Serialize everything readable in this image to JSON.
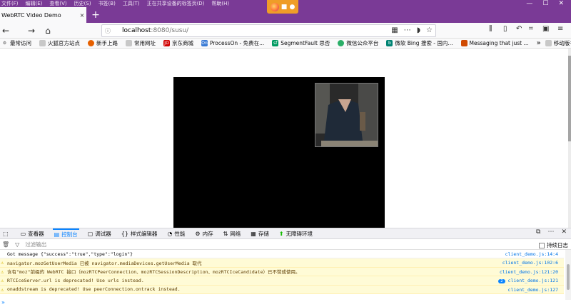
{
  "menubar": [
    "文件(F)",
    "编辑(E)",
    "查看(V)",
    "历史(S)",
    "书签(B)",
    "工具(T)",
    "正在共享设备的标签页(D)",
    "帮助(H)"
  ],
  "tab": {
    "title": "WebRTC Video Demo",
    "close": "×"
  },
  "newtab": "+",
  "url": {
    "host": "localhost",
    "rest": ":8080/susu/"
  },
  "bookmarks": [
    {
      "label": "最常访问",
      "color": "#2b6fd6"
    },
    {
      "label": "火狐官方站点",
      "color": "#e66000"
    },
    {
      "label": "新手上路",
      "color": "#e66000"
    },
    {
      "label": "常用网址",
      "color": "#888888"
    },
    {
      "label": "京东商城",
      "color": "#d00000"
    },
    {
      "label": "ProcessOn - 免费在...",
      "color": "#3a7bd5"
    },
    {
      "label": "SegmentFault 思否",
      "color": "#009a61"
    },
    {
      "label": "微信公众平台",
      "color": "#2aae67"
    },
    {
      "label": "微软 Bing 搜索 - 国内...",
      "color": "#008373"
    },
    {
      "label": "Messaging that just ...",
      "color": "#d04a02"
    }
  ],
  "bookmarks_more": "»",
  "mobile_bookmarks": "移动版书签",
  "devtools_tabs": [
    {
      "label": "查看器",
      "icon": "inspector-icon"
    },
    {
      "label": "控制台",
      "icon": "console-icon",
      "active": true
    },
    {
      "label": "调试器",
      "icon": "debugger-icon"
    },
    {
      "label": "样式编辑器",
      "icon": "style-editor-icon"
    },
    {
      "label": "性能",
      "icon": "performance-icon"
    },
    {
      "label": "内存",
      "icon": "memory-icon"
    },
    {
      "label": "网络",
      "icon": "network-icon"
    },
    {
      "label": "存储",
      "icon": "storage-icon"
    },
    {
      "label": "无障碍环境",
      "icon": "accessibility-icon"
    }
  ],
  "filter_placeholder": "过滤输出",
  "persist_logs": "持续日志",
  "console": [
    {
      "type": "log",
      "msg": "Got message {\"success\":\"true\",\"type\":\"login\"}",
      "src": "client_demo.js:14:4"
    },
    {
      "type": "warn",
      "msg": "navigator.mozGetUserMedia 已被 navigator.mediaDevices.getUserMedia 取代",
      "src": "client_demo.js:102:6"
    },
    {
      "type": "warn",
      "msg": "含有\"moz\"前缀的 WebRTC 接口（mozRTCPeerConnection、mozRTCSessionDescription、mozRTCIceCandidate）已不赞成使用。",
      "src": "client_demo.js:121:20"
    },
    {
      "type": "warn",
      "msg": "RTCIceServer.url is deprecated! Use urls instead.",
      "src": "client_demo.js:121",
      "badge": "2"
    },
    {
      "type": "warn",
      "msg": "onaddstream is deprecated! Use peerConnection.ontrack instead.",
      "src": "client_demo.js:127"
    }
  ],
  "prompt": "»",
  "colors": {
    "titlebar": "#7a3a96",
    "share": "#ef9d28",
    "accent": "#0a84ff",
    "warn_bg": "#fffbd6"
  }
}
